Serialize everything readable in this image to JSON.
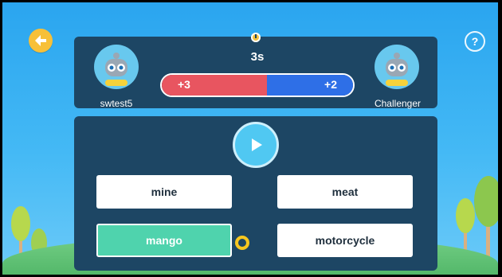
{
  "timer": {
    "value": "3s"
  },
  "player": {
    "name": "swtest5",
    "score": "+3"
  },
  "opponent": {
    "name": "Challenger",
    "score": "+2"
  },
  "score_bar": {
    "player_fraction": 0.55
  },
  "options": [
    {
      "label": "mine",
      "selected": false
    },
    {
      "label": "meat",
      "selected": false
    },
    {
      "label": "mango",
      "selected": true
    },
    {
      "label": "motorcycle",
      "selected": false
    }
  ],
  "colors": {
    "panel": "#1d4664",
    "player": "#e85560",
    "opponent": "#2e6fe7",
    "selected": "#4fd3ad",
    "accent": "#f7c038"
  },
  "icons": {
    "back": "back-arrow-icon",
    "help": "question-icon",
    "timer": "timer-icon",
    "play": "play-icon",
    "pending": "pending-ring-icon"
  }
}
